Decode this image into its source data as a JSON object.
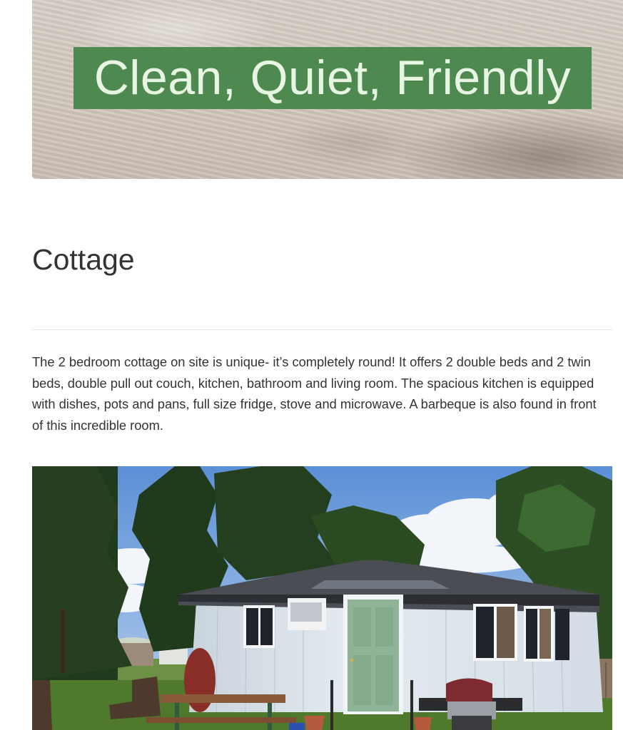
{
  "hero": {
    "title": "Clean, Quiet, Friendly"
  },
  "section": {
    "title": "Cottage",
    "description": "The 2 bedroom cottage on site is unique- it’s completely round! It offers 2 double beds and 2 twin beds, double pull out couch, kitchen, bathroom and living room. The spacious kitchen is equipped with dishes, pots and pans, full size fridge, stove and microwave. A barbeque is also found in front of this incredible room."
  },
  "colors": {
    "hero_label_bg": "#4e8a4f",
    "hero_label_text": "#e9f5e3",
    "body_text": "#333333",
    "cottage_door": "#8fb396"
  }
}
